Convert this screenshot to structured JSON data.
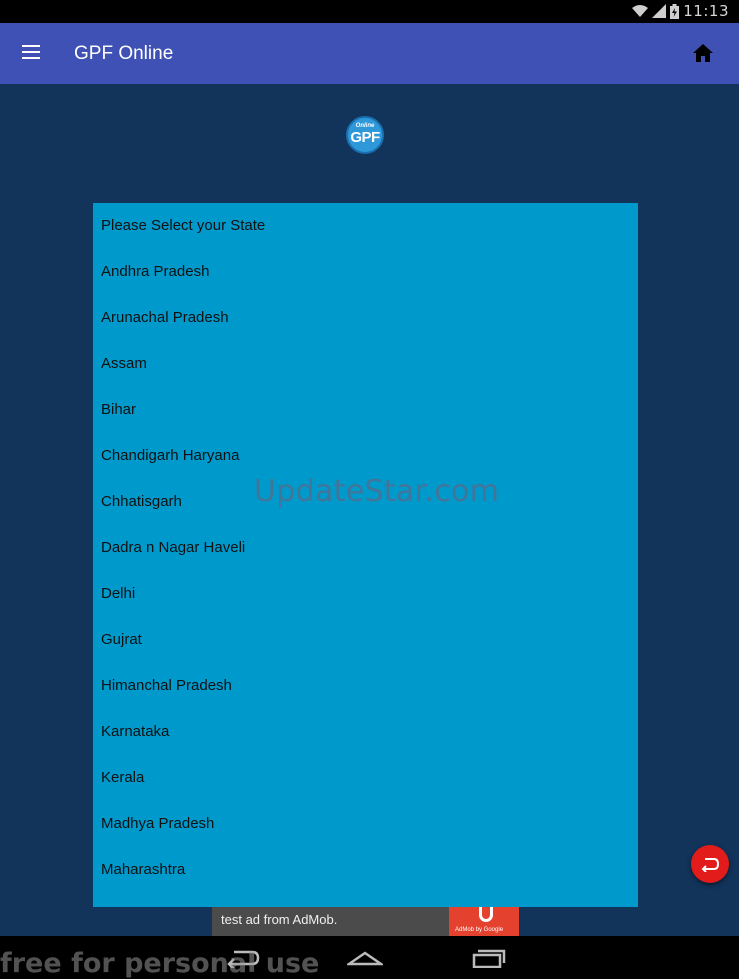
{
  "status_bar": {
    "time": "11:13",
    "icons": [
      "wifi-icon",
      "signal-icon",
      "battery-charging-icon"
    ]
  },
  "app_bar": {
    "title": "GPF Online",
    "menu_icon": "hamburger-menu-icon",
    "home_icon": "home-icon"
  },
  "logo": {
    "small_text": "Online",
    "main_text": "GPF"
  },
  "state_list": {
    "items": [
      "Please Select your State",
      "Andhra Pradesh",
      "Arunachal Pradesh",
      "Assam",
      "Bihar",
      "Chandigarh Haryana",
      "Chhatisgarh",
      "Dadra n Nagar Haveli",
      "Delhi",
      "Gujrat",
      "Himanchal Pradesh",
      "Karnataka",
      "Kerala",
      "Madhya Pradesh",
      "Maharashtra"
    ]
  },
  "watermark": "UpdateStar.com",
  "fab": {
    "icon": "undo-back-icon",
    "color": "#e21b1b"
  },
  "ad": {
    "text": "test ad from AdMob.",
    "logo_caption": "AdMob by Google"
  },
  "footer_watermark": "free for personal use",
  "nav_bar": {
    "buttons": [
      "back-icon",
      "home-icon",
      "recents-icon"
    ]
  },
  "colors": {
    "app_bar": "#3f51b5",
    "background": "#12335a",
    "list_background": "#0099cc"
  }
}
